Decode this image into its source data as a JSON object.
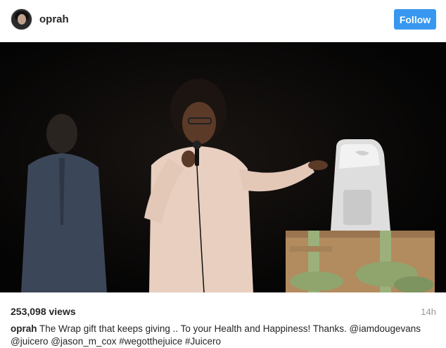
{
  "header": {
    "username": "oprah",
    "follow_label": "Follow"
  },
  "post": {
    "views": "253,098 views",
    "time": "14h",
    "caption_author": "oprah",
    "caption_text": "The Wrap gift that keeps giving .. To your Health and Happiness! Thanks. @iamdougevans @juicero @jason_m_cox #wegotthejuice #Juicero"
  },
  "colors": {
    "follow_button": "#3897f0",
    "video_background": "#050505"
  },
  "icons": {
    "avatar": "profile-photo"
  }
}
